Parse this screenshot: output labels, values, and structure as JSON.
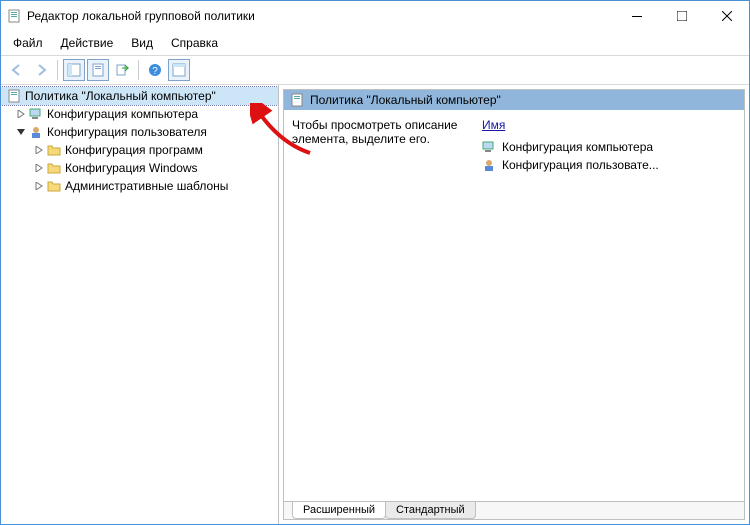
{
  "title": "Редактор локальной групповой политики",
  "menu": {
    "file": "Файл",
    "action": "Действие",
    "view": "Вид",
    "help": "Справка"
  },
  "tree": {
    "root": "Политика \"Локальный компьютер\"",
    "computer": "Конфигурация компьютера",
    "user": "Конфигурация пользователя",
    "user_children": {
      "software": "Конфигурация программ",
      "windows": "Конфигурация Windows",
      "admin": "Административные шаблоны"
    }
  },
  "detail": {
    "heading": "Политика \"Локальный компьютер\"",
    "hint": "Чтобы просмотреть описание элемента, выделите его.",
    "name_col": "Имя",
    "items": {
      "computer": "Конфигурация компьютера",
      "user": "Конфигурация пользовате..."
    }
  },
  "tabs": {
    "extended": "Расширенный",
    "standard": "Стандартный"
  }
}
